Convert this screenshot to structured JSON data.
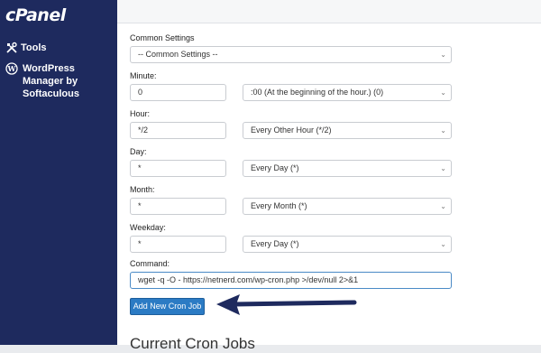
{
  "brand": {
    "logo_text": "cPanel"
  },
  "sidebar": {
    "items": [
      {
        "label": "Tools",
        "icon": "tools-icon"
      },
      {
        "label": "WordPress Manager by Softaculous",
        "icon": "wordpress-icon"
      }
    ]
  },
  "form": {
    "common": {
      "label": "Common Settings",
      "value": "-- Common Settings --"
    },
    "minute": {
      "label": "Minute:",
      "value": "0",
      "select": ":00 (At the beginning of the hour.) (0)"
    },
    "hour": {
      "label": "Hour:",
      "value": "*/2",
      "select": "Every Other Hour (*/2)"
    },
    "day": {
      "label": "Day:",
      "value": "*",
      "select": "Every Day (*)"
    },
    "month": {
      "label": "Month:",
      "value": "*",
      "select": "Every Month (*)"
    },
    "weekday": {
      "label": "Weekday:",
      "value": "*",
      "select": "Every Day (*)"
    },
    "command": {
      "label": "Command:",
      "value": "wget -q -O - https://netnerd.com/wp-cron.php >/dev/null 2>&1"
    },
    "submit_label": "Add New Cron Job"
  },
  "section_heading": "Current Cron Jobs",
  "colors": {
    "sidebar": "#1e2a5e",
    "button": "#2b7bc4",
    "arrow": "#1e2a5e"
  }
}
